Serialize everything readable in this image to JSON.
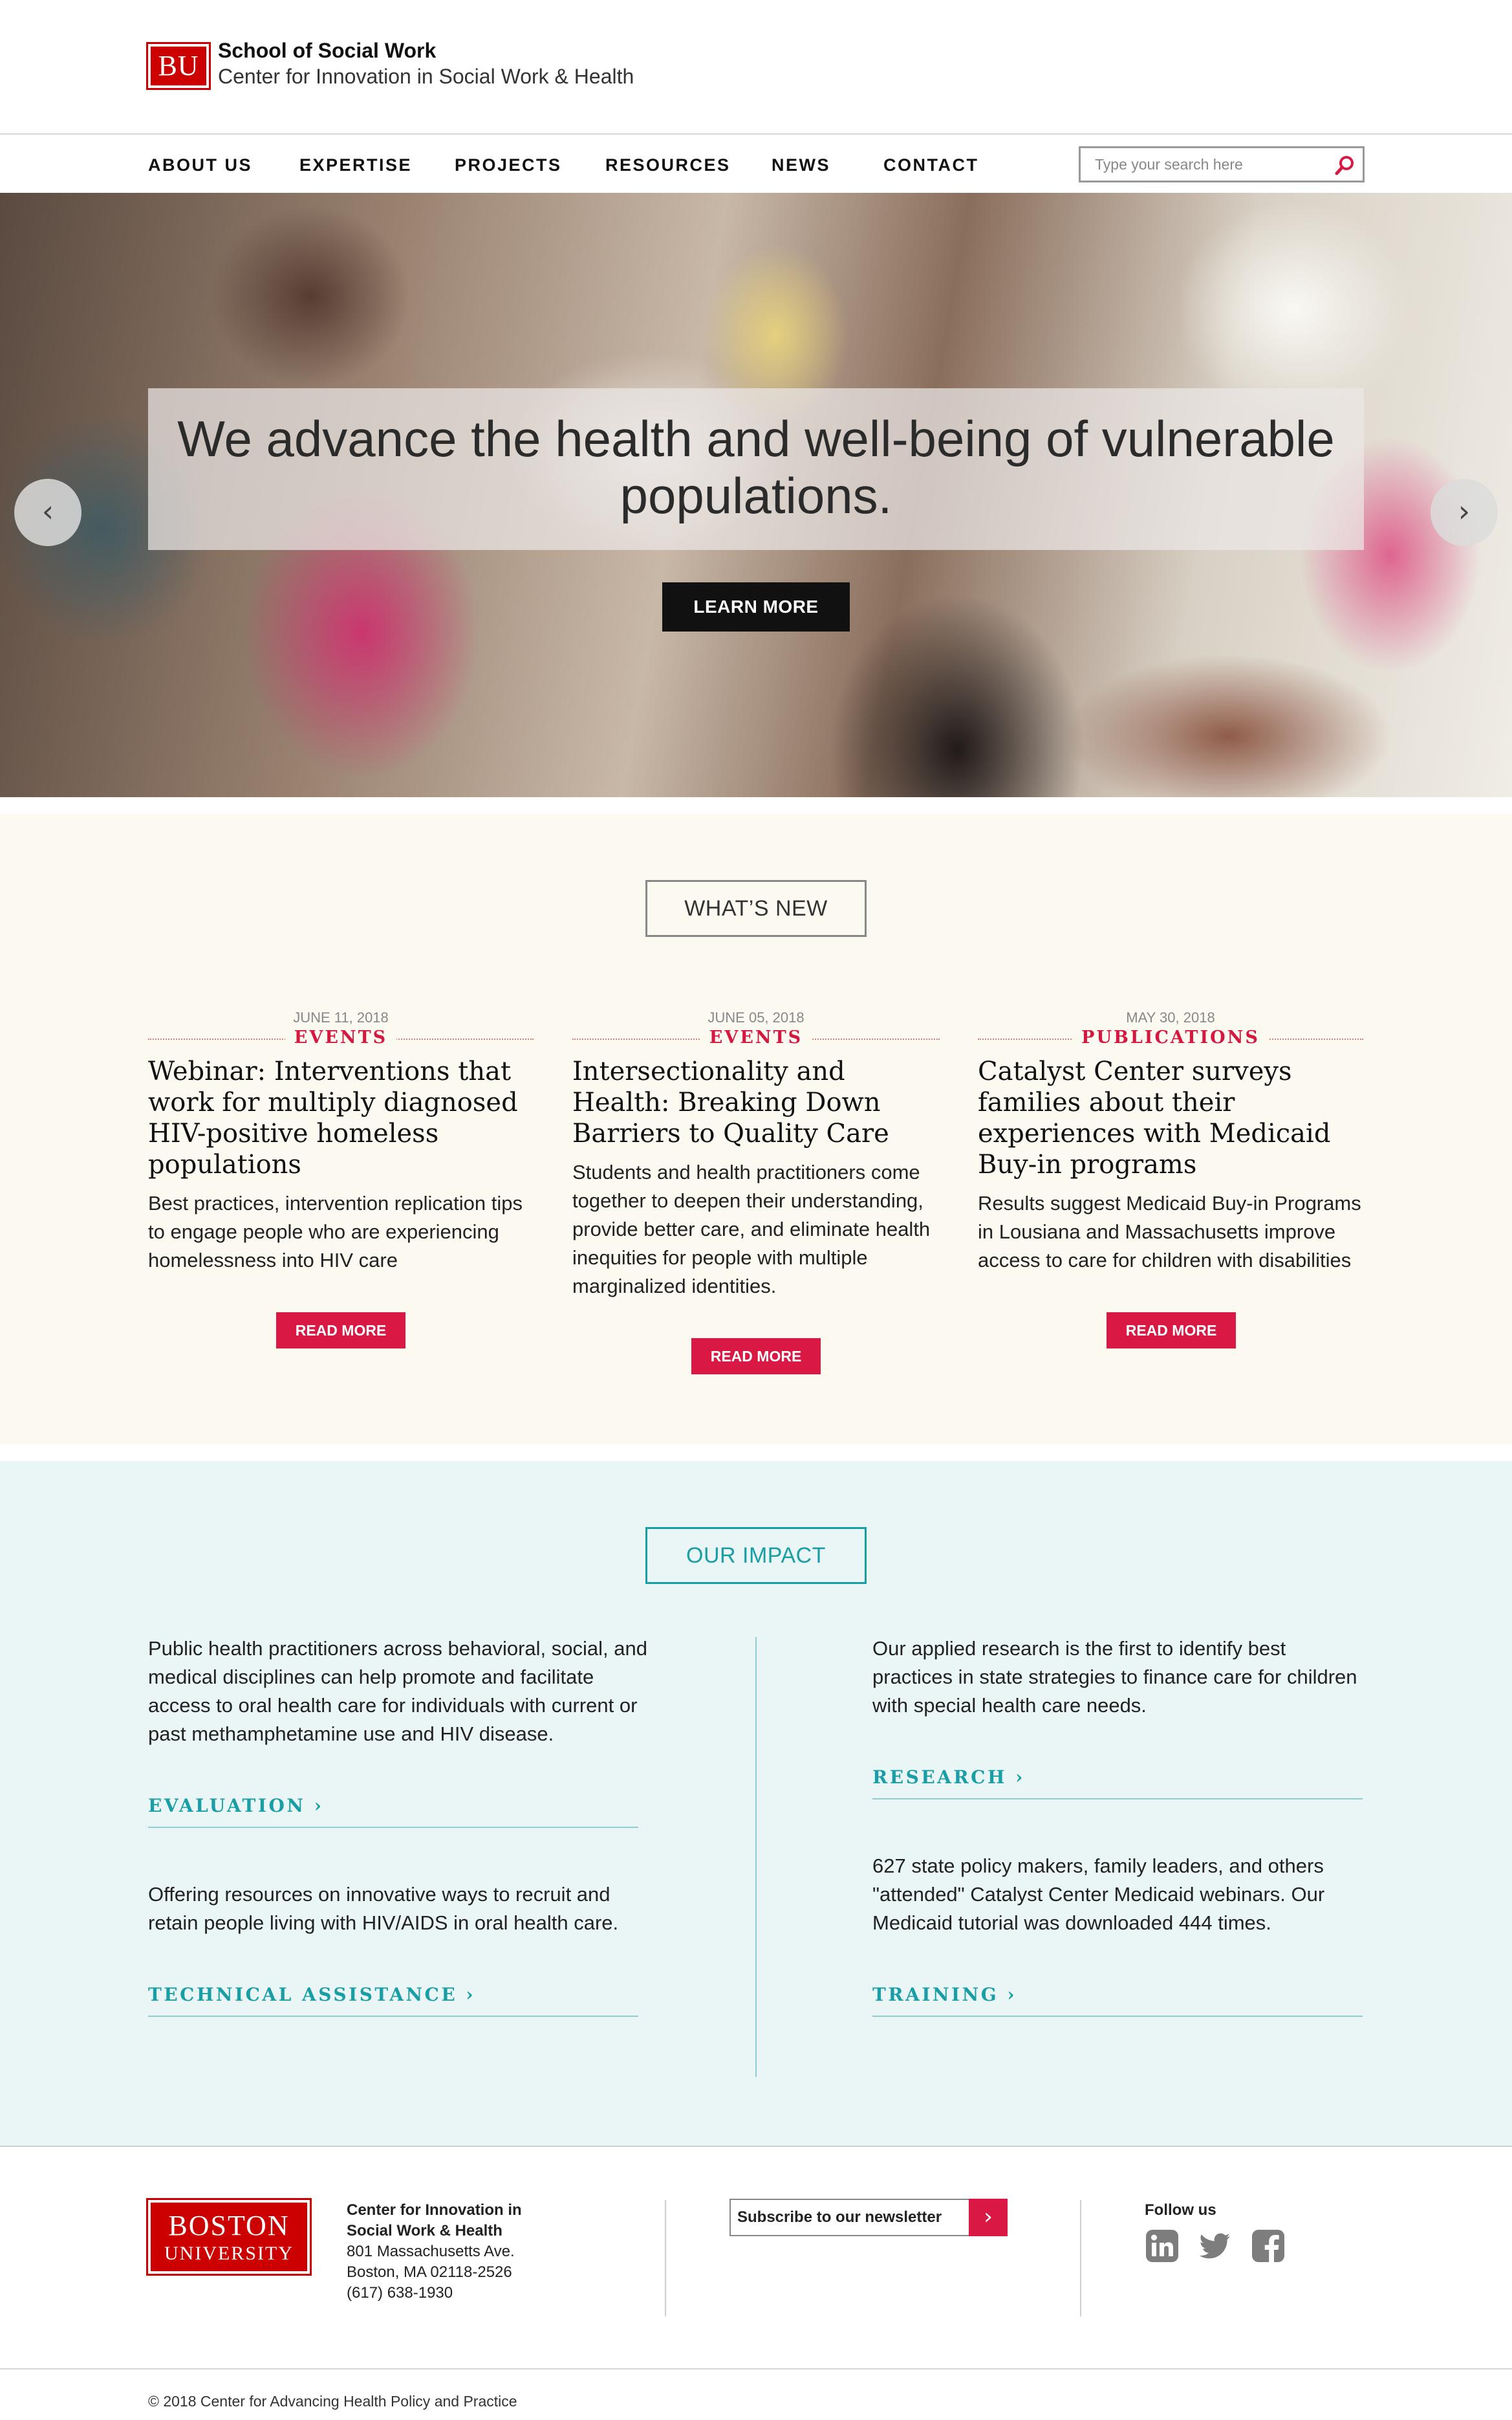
{
  "header": {
    "logo_text": "BU",
    "org_title": "School of Social Work",
    "org_subtitle": "Center for Innovation in Social Work & Health"
  },
  "nav": {
    "items": [
      "ABOUT US",
      "EXPERTISE",
      "PROJECTS",
      "RESOURCES",
      "NEWS",
      "CONTACT"
    ],
    "search_placeholder": "Type your search here",
    "search_icon": "search-icon"
  },
  "hero": {
    "headline": "We advance the health and well-being of vulnerable populations.",
    "cta_label": "LEARN MORE",
    "prev_arrow": "‹",
    "next_arrow": "›"
  },
  "whats_new": {
    "title": "WHAT’S NEW",
    "items": [
      {
        "date": "JUNE 11, 2018",
        "category": "EVENTS",
        "title": "Webinar: Interventions that work for multiply diagnosed HIV-positive homeless populations",
        "body": "Best practices, intervention replication tips to engage people who are experiencing homelessness into HIV care",
        "cta": "READ MORE"
      },
      {
        "date": "JUNE 05, 2018",
        "category": "EVENTS",
        "title": "Intersectionality and Health: Breaking Down Barriers to Quality Care",
        "body": "Students and health practitioners come together to deepen their understanding, provide better care, and eliminate health inequities for people with multiple marginalized identities.",
        "cta": "READ MORE"
      },
      {
        "date": "MAY 30, 2018",
        "category": "PUBLICATIONS",
        "title": "Catalyst Center surveys families about their experiences with Medicaid Buy-in programs",
        "body": "Results suggest Medicaid Buy-in Programs in Lousiana and Massachusetts improve access to care for children with disabilities",
        "cta": "READ MORE"
      }
    ]
  },
  "impact": {
    "title": "OUR IMPACT",
    "left": [
      {
        "text": "Public health practitioners across behavioral, social, and medical disciplines can help promote and facilitate access to oral health care for individuals with current or past methamphetamine use and HIV disease.",
        "link": "EVALUATION ›"
      },
      {
        "text": "Offering resources on innovative ways to recruit and retain people living with HIV/AIDS in oral health care.",
        "link": "TECHNICAL ASSISTANCE ›"
      }
    ],
    "right": [
      {
        "text": "Our applied research is the first to identify best practices in state strategies to finance care for children with special health care needs.",
        "link": "RESEARCH ›"
      },
      {
        "text": "627 state policy makers, family leaders, and others \"attended\" Catalyst Center Medicaid webinars. Our Medicaid tutorial was downloaded 444 times.",
        "link": "TRAINING ›"
      }
    ]
  },
  "footer": {
    "logo_line1": "BOSTON",
    "logo_line2": "UNIVERSITY",
    "address_name_1": "Center for Innovation in",
    "address_name_2": "Social Work & Health",
    "address_street": "801 Massachusetts Ave.",
    "address_city": "Boston, MA 02118-2526",
    "address_phone": "(617) 638-1930",
    "newsletter_placeholder": "Subscribe to our newsletter",
    "newsletter_button": "›",
    "follow_label": "Follow us",
    "social": [
      "linkedin-icon",
      "twitter-icon",
      "facebook-icon"
    ],
    "copyright": "© 2018 Center for Advancing Health Policy and Practice"
  },
  "colors": {
    "brand_red": "#d91843",
    "bu_red": "#cc0000",
    "teal": "#1a9ea6",
    "cream": "#fcf9f1",
    "light_teal_bg": "#eaf5f6"
  }
}
